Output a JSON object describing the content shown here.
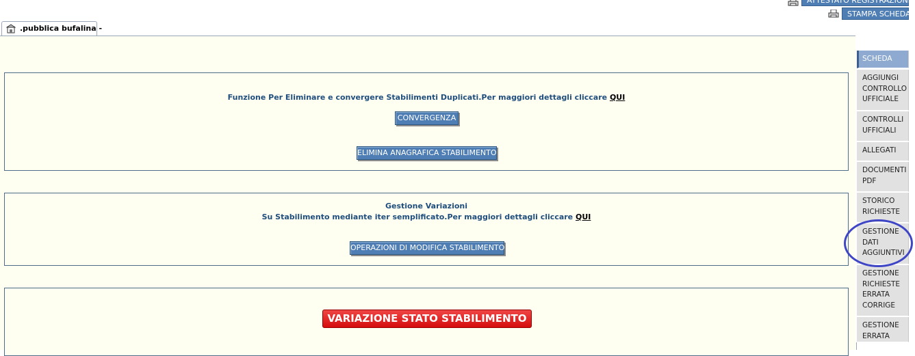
{
  "header": {
    "attestato_label": "ATTESTATO REGISTRAZIONE",
    "stampa_label": "STAMPA SCHEDA"
  },
  "tab": {
    "label": ".pubblica bufalina -"
  },
  "convergenza_section": {
    "info_text": "Funzione Per Eliminare e convergere Stabilimenti Duplicati.Per maggiori dettagli cliccare",
    "info_link": "QUI",
    "convergenza_label": "CONVERGENZA",
    "elimina_label": "ELIMINA ANAGRAFICA STABILIMENTO"
  },
  "variazioni_section": {
    "title": "Gestione Variazioni",
    "info_text": "Su Stabilimento mediante iter semplificato.Per maggiori dettagli cliccare",
    "info_link": "QUI",
    "operazioni_label": "OPERAZIONI DI MODIFICA STABILIMENTO"
  },
  "stato_section": {
    "variazione_label": "VARIAZIONE STATO STABILIMENTO"
  },
  "sidebar": {
    "items": [
      {
        "label": "SCHEDA",
        "active": true
      },
      {
        "label": "AGGIUNGI CONTROLLO UFFICIALE"
      },
      {
        "label": "CONTROLLI UFFICIALI"
      },
      {
        "label": "ALLEGATI"
      },
      {
        "label": "DOCUMENTI PDF"
      },
      {
        "label": "STORICO RICHIESTE"
      },
      {
        "label": "GESTIONE DATI AGGIUNTIVI",
        "highlighted": true
      },
      {
        "label": "GESTIONE RICHIESTE ERRATA CORRIGE"
      },
      {
        "label": "GESTIONE ERRATA"
      }
    ]
  },
  "colors": {
    "button_blue": "#4f7eb4",
    "info_text": "#1f4e7d",
    "panel_bg": "#fefef1",
    "red_button": "#d50d0d",
    "highlight_circle": "#3f46c5"
  }
}
